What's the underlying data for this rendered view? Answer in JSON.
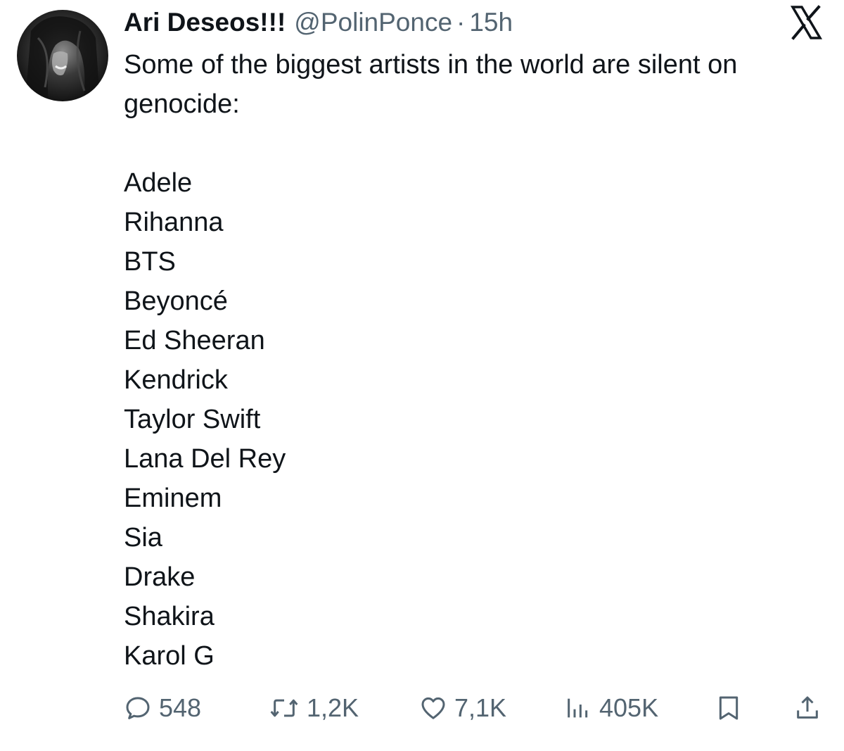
{
  "tweet": {
    "author": {
      "display_name": "Ari Deseos!!!",
      "handle": "@PolinPonce",
      "separator": "·",
      "time": "15h",
      "avatar_icon": "profile-photo"
    },
    "platform_icon": "x-logo-icon",
    "text_intro": "Some of the biggest artists in the world are silent on genocide:",
    "artists": [
      "Adele",
      "Rihanna",
      "BTS",
      "Beyoncé",
      "Ed Sheeran",
      "Kendrick",
      "Taylor Swift",
      "Lana Del Rey",
      "Eminem",
      "Sia",
      "Drake",
      "Shakira",
      "Karol G"
    ],
    "actions": {
      "replies": "548",
      "retweets": "1,2K",
      "likes": "7,1K",
      "views": "405K",
      "bookmark_icon": "bookmark-icon",
      "share_icon": "share-icon"
    }
  },
  "colors": {
    "text_primary": "#0f1419",
    "text_secondary": "#536471",
    "background": "#ffffff"
  }
}
